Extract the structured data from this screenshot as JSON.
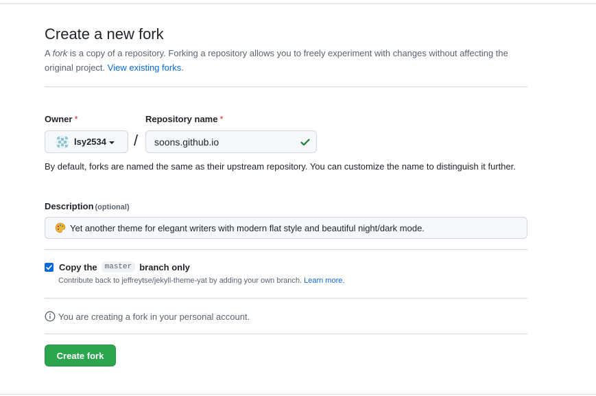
{
  "header": {
    "title": "Create a new fork",
    "intro_prefix": "A ",
    "intro_fork_word": "fork",
    "intro_middle": " is a copy of a repository. Forking a repository allows you to freely experiment with changes without affecting the original project. ",
    "intro_link": "View existing forks."
  },
  "owner": {
    "label": "Owner",
    "required_mark": "*",
    "selected": "lsy2534"
  },
  "repository": {
    "label": "Repository name",
    "required_mark": "*",
    "value": "soons.github.io",
    "valid": true
  },
  "name_help": "By default, forks are named the same as their upstream repository. You can customize the name to distinguish it further.",
  "description": {
    "label": "Description",
    "optional": "(optional)",
    "emoji_icon": "artist-palette-icon",
    "value": "Yet another theme for elegant writers with modern flat style and beautiful night/dark mode."
  },
  "copy_branch": {
    "checked": true,
    "label_before": "Copy the",
    "branch": "master",
    "label_after": "branch only",
    "sub_text": "Contribute back to jeffreytse/jekyll-theme-yat by adding your own branch.",
    "sub_link": "Learn more."
  },
  "info": {
    "icon": "info-icon",
    "text": "You are creating a fork in your personal account."
  },
  "create_button": "Create fork",
  "colors": {
    "accent": "#0969da",
    "primary_button": "#2da44e",
    "success": "#1a7f37",
    "danger": "#d1242f"
  }
}
